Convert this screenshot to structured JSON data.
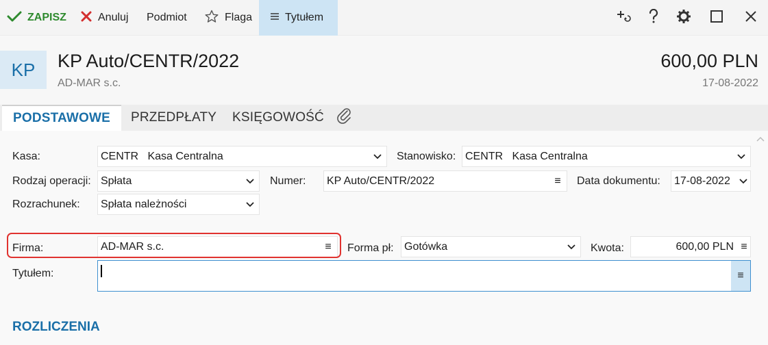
{
  "toolbar": {
    "save_label": "ZAPISZ",
    "cancel_label": "Anuluj",
    "subject_label": "Podmiot",
    "flag_label": "Flaga",
    "title_label": "Tytułem"
  },
  "header": {
    "badge": "KP",
    "title": "KP Auto/CENTR/2022",
    "subtitle": "AD-MAR s.c.",
    "amount": "600,00 PLN",
    "date": "17-08-2022"
  },
  "tabs": [
    {
      "label": "PODSTAWOWE"
    },
    {
      "label": "PRZEDPŁATY"
    },
    {
      "label": "KSIĘGOWOŚĆ"
    }
  ],
  "form": {
    "kasa": {
      "label": "Kasa:",
      "value": "CENTR   Kasa Centralna"
    },
    "stanowisko": {
      "label": "Stanowisko:",
      "value": "CENTR   Kasa Centralna"
    },
    "rodzaj": {
      "label": "Rodzaj operacji:",
      "value": "Spłata"
    },
    "numer": {
      "label": "Numer:",
      "value": "KP Auto/CENTR/2022"
    },
    "data": {
      "label": "Data dokumentu:",
      "value": "17-08-2022"
    },
    "rozrachunek": {
      "label": "Rozrachunek:",
      "value": "Spłata należności"
    },
    "firma": {
      "label": "Firma:",
      "value": "AD-MAR s.c."
    },
    "forma": {
      "label": "Forma pł:",
      "value": "Gotówka"
    },
    "kwota": {
      "label": "Kwota:",
      "value": "600,00 PLN"
    },
    "tytulem": {
      "label": "Tytułem:",
      "value": ""
    }
  },
  "section": {
    "title": "ROZLICZENIA"
  },
  "colors": {
    "accent": "#1a6fa8",
    "save_green": "#2e8a2e",
    "cancel_red": "#d32f2f",
    "highlight": "#e0322f"
  }
}
